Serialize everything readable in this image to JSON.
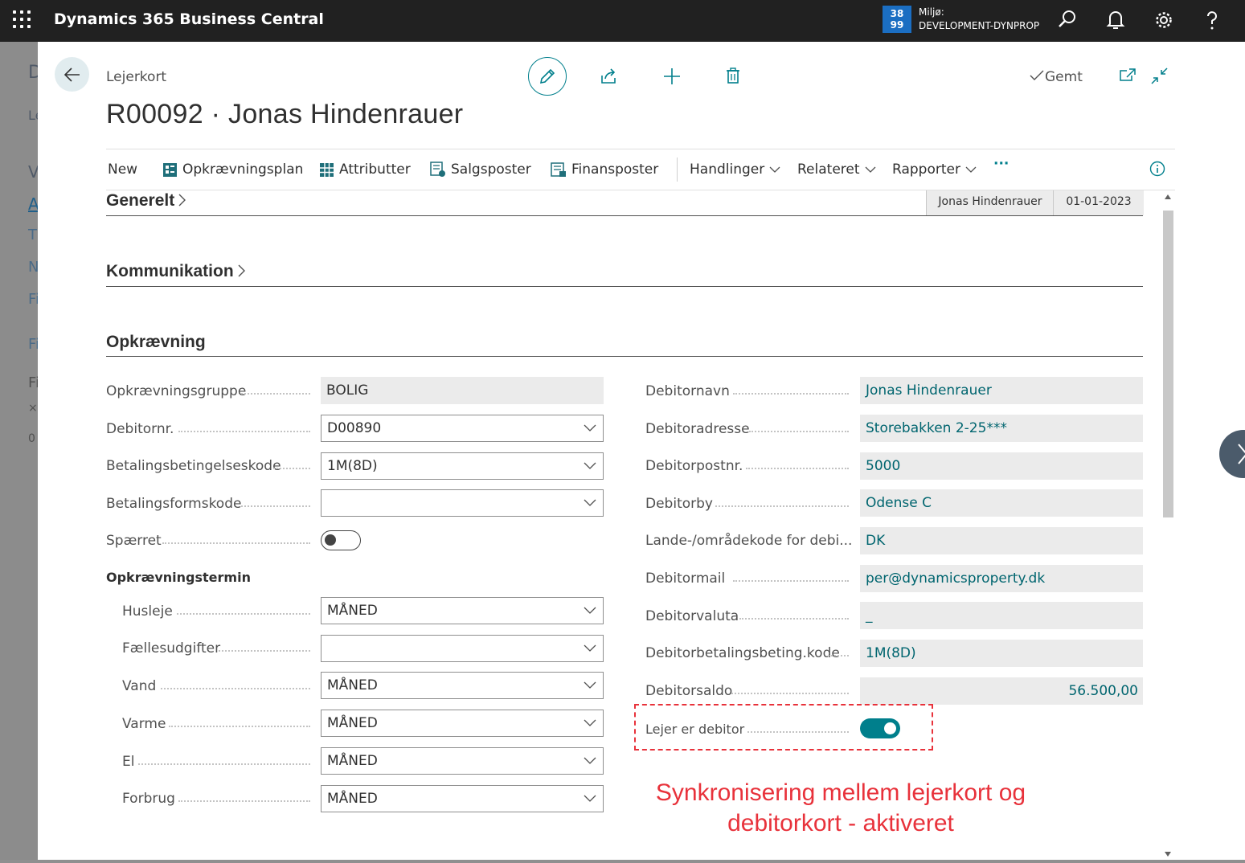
{
  "app": {
    "title": "Dynamics 365 Business Central"
  },
  "environment": {
    "badge_line1": "38",
    "badge_line2": "99",
    "label": "Miljø:",
    "name": "DEVELOPMENT-DYNPROP"
  },
  "background_letters": [
    "D",
    "Le",
    "V",
    "A",
    "Ti",
    "N",
    "Fi",
    "Fi",
    "Fi",
    "×",
    "0"
  ],
  "header": {
    "breadcrumb": "Lejerkort",
    "title": "R00092 · Jonas Hindenrauer",
    "saved_label": "Gemt"
  },
  "actions": {
    "new": "New",
    "opkraevningsplan": "Opkrævningsplan",
    "attributter": "Attributter",
    "salgsposter": "Salgsposter",
    "finansposter": "Finansposter",
    "handlinger": "Handlinger",
    "relateret": "Relateret",
    "rapporter": "Rapporter",
    "more": "···"
  },
  "sections": {
    "generelt": "Generelt",
    "generelt_summary": [
      "Jonas Hindenrauer",
      "01-01-2023"
    ],
    "kommunikation": "Kommunikation",
    "opkraevning": "Opkrævning"
  },
  "left_fields": {
    "opkraevningsgruppe": {
      "label": "Opkrævningsgruppe",
      "value": "BOLIG"
    },
    "debitornr": {
      "label": "Debitornr.",
      "value": "D00890"
    },
    "betalingsbetingelseskode": {
      "label": "Betalingsbetingelseskode",
      "value": "1M(8D)"
    },
    "betalingsformskode": {
      "label": "Betalingsformskode",
      "value": ""
    },
    "spaerret": {
      "label": "Spærret",
      "value": false
    }
  },
  "opkraevningstermin": {
    "heading": "Opkrævningstermin",
    "husleje": {
      "label": "Husleje",
      "value": "MÅNED"
    },
    "faellesudgifter": {
      "label": "Fællesudgifter",
      "value": ""
    },
    "vand": {
      "label": "Vand",
      "value": "MÅNED"
    },
    "varme": {
      "label": "Varme",
      "value": "MÅNED"
    },
    "el": {
      "label": "El",
      "value": "MÅNED"
    },
    "forbrug": {
      "label": "Forbrug",
      "value": "MÅNED"
    }
  },
  "right_fields": {
    "debitornavn": {
      "label": "Debitornavn",
      "value": "Jonas Hindenrauer"
    },
    "debitoradresse": {
      "label": "Debitoradresse",
      "value": "Storebakken 2-25***"
    },
    "debitorpostnr": {
      "label": "Debitorpostnr.",
      "value": "5000"
    },
    "debitorby": {
      "label": "Debitorby",
      "value": "Odense C"
    },
    "landekode": {
      "label": "Lande-/områdekode for debi...",
      "value": "DK"
    },
    "debitormail": {
      "label": "Debitormail",
      "value": "per@dynamicsproperty.dk"
    },
    "debitorvaluta": {
      "label": "Debitorvaluta",
      "value": "_"
    },
    "debitorbetalingsbeting": {
      "label": "Debitorbetalingsbeting.kode",
      "value": "1M(8D)"
    },
    "debitorsaldo": {
      "label": "Debitorsaldo",
      "value": "56.500,00"
    },
    "lejer_er_debitor": {
      "label": "Lejer er debitor",
      "value": true
    }
  },
  "annotation": {
    "line1": "Synkronisering mellem lejerkort og",
    "line2": "debitorkort - aktiveret"
  },
  "colors": {
    "accent": "#007f8c",
    "topbar": "#212121",
    "annotation": "#e8323b"
  }
}
